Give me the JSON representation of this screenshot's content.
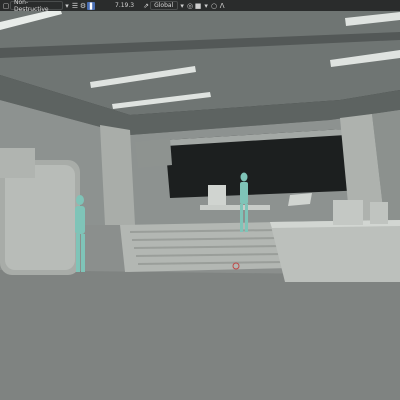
{
  "toolbar": {
    "mode_icon": "cube-icon",
    "mode_select": "Non-Destructive",
    "version": "7.19.3",
    "orientation_select": "Global",
    "icons": [
      "cube-icon",
      "chevron-down-icon",
      "layers-icon",
      "gear-icon",
      "pause-icon",
      "share-icon",
      "square-icon",
      "chevron-down-icon",
      "circle-icon",
      "wave-icon"
    ]
  },
  "colors": {
    "toolbar_bg": "#242626",
    "accent": "#4a6fb4",
    "model_gray": "#a6aaa6",
    "figure_teal": "#7fc4b8"
  }
}
